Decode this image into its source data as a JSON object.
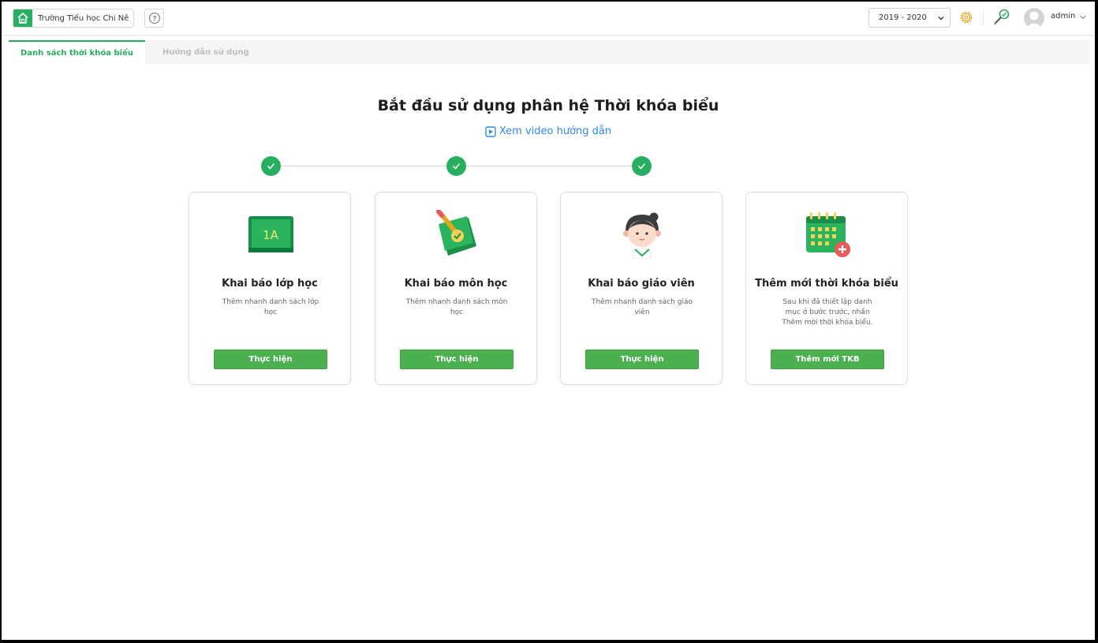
{
  "header": {
    "school_name": "Trường Tiểu học Chi Nê",
    "year": "2019 - 2020",
    "user": "admin"
  },
  "tabs": [
    {
      "label": "Danh sách thời khóa biểu",
      "active": true
    },
    {
      "label": "Hướng dẫn sử dụng",
      "active": false
    }
  ],
  "main": {
    "title": "Bắt đầu sử dụng phân hệ Thời khóa biểu",
    "video_link": "Xem video hướng dẫn",
    "steps_completed": 3
  },
  "cards": [
    {
      "title": "Khai báo lớp học",
      "desc": "Thêm nhanh danh sách lớp học",
      "button": "Thực hiện",
      "icon_label": "1A",
      "icon": "class-board-icon"
    },
    {
      "title": "Khai báo môn học",
      "desc": "Thêm nhanh danh sách môn học",
      "button": "Thực hiện",
      "icon": "subject-note-icon"
    },
    {
      "title": "Khai báo giáo viên",
      "desc": "Thêm nhanh danh sách giáo viên",
      "button": "Thực hiện",
      "icon": "teacher-icon"
    },
    {
      "title": "Thêm mới thời khóa biểu",
      "desc": "Sau khi đã thiết lập danh mục ở bước trước, nhấn Thêm mới thời khóa biểu.",
      "button": "Thêm mới TKB",
      "icon": "calendar-add-icon"
    }
  ],
  "colors": {
    "primary": "#27ae60",
    "button": "#4caf50",
    "link": "#2f8be6"
  }
}
